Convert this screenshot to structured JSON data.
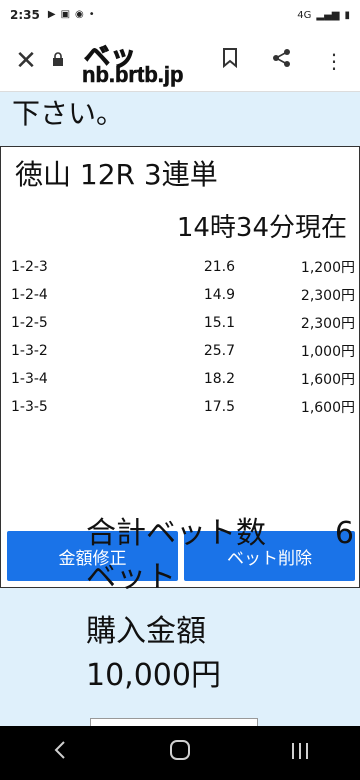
{
  "status": {
    "time": "2:35",
    "icons": [
      "play-icon",
      "image-icon",
      "vpn-icon",
      "dot-icon"
    ],
    "network": "4G",
    "battery": "▮"
  },
  "browser": {
    "title_line1": "ベッ",
    "title_line2": "nb.brtb.jp"
  },
  "page": {
    "cut_text": "下さい。",
    "card": {
      "title": "徳山 12R 3連単",
      "time": "14時34分現在",
      "rows": [
        {
          "combo": "1-2-3",
          "odds": "21.6",
          "amount": "1,200円"
        },
        {
          "combo": "1-2-4",
          "odds": "14.9",
          "amount": "2,300円"
        },
        {
          "combo": "1-2-5",
          "odds": "15.1",
          "amount": "2,300円"
        },
        {
          "combo": "1-3-2",
          "odds": "25.7",
          "amount": "1,000円"
        },
        {
          "combo": "1-3-4",
          "odds": "18.2",
          "amount": "1,600円"
        },
        {
          "combo": "1-3-5",
          "odds": "17.5",
          "amount": "1,600円"
        }
      ],
      "edit_button": "金額修正",
      "delete_button": "ベット削除"
    },
    "summary": {
      "bet_count_label": "合計ベット数",
      "bet_count_value": "6",
      "bet_unit": "ベット",
      "purchase_label": "購入金額",
      "purchase_value": "10,000円"
    }
  },
  "colors": {
    "accent": "#1a73e8",
    "page_background": "#dff0fb"
  }
}
